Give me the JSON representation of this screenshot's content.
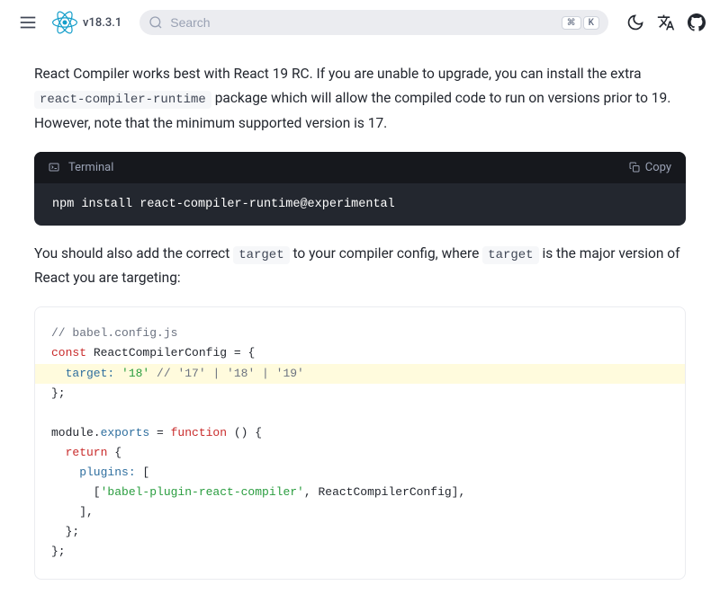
{
  "header": {
    "version": "v18.3.1",
    "search_placeholder": "Search",
    "kbd1": "⌘",
    "kbd2": "K"
  },
  "content": {
    "para1_pre": "React Compiler works best with React 19 RC. If you are unable to upgrade, you can install the extra ",
    "para1_code": "react-compiler-runtime",
    "para1_post": " package which will allow the compiled code to run on versions prior to 19. However, note that the minimum supported version is 17.",
    "terminal": {
      "title": "Terminal",
      "copy_label": "Copy",
      "command": "npm install react-compiler-runtime@experimental"
    },
    "para2_a": "You should also add the correct ",
    "para2_code1": "target",
    "para2_b": " to your compiler config, where ",
    "para2_code2": "target",
    "para2_c": " is the major version of React you are targeting:",
    "code": {
      "l1": "// babel.config.js",
      "l2_kw": "const",
      "l2_var": " ReactCompilerConfig ",
      "l2_eq": "= {",
      "l3_prop": "  target:",
      "l3_str": " '18'",
      "l3_comment": " // '17' | '18' | '19'",
      "l4": "};",
      "l5": "",
      "l6_a": "module.",
      "l6_b": "exports",
      "l6_c": " = ",
      "l6_d": "function",
      "l6_e": " () {",
      "l7_kw": "  return",
      "l7_rest": " {",
      "l8_prop": "    plugins:",
      "l8_rest": " [",
      "l9_pre": "      [",
      "l9_str": "'babel-plugin-react-compiler'",
      "l9_mid": ", ReactCompilerConfig],",
      "l10": "    ],",
      "l11": "  };",
      "l12": "};"
    }
  }
}
